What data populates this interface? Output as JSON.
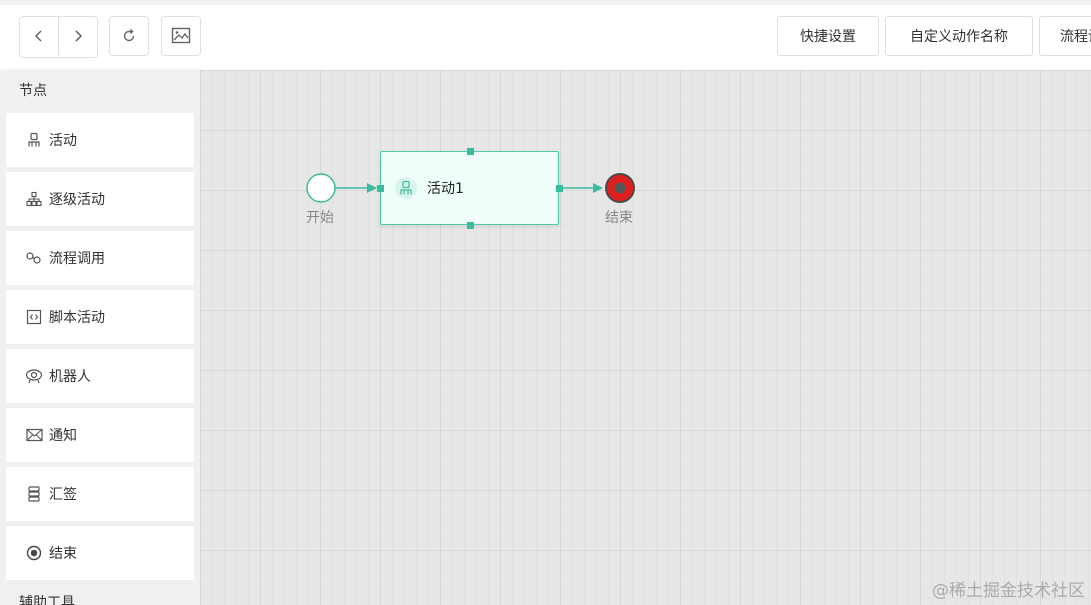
{
  "toolbar": {
    "back_icon": "chevron-left-icon",
    "forward_icon": "chevron-right-icon",
    "reset_icon": "refresh-icon",
    "image_icon": "image-icon",
    "quick_settings_label": "快捷设置",
    "custom_action_label": "自定义动作名称",
    "process_label": "流程设"
  },
  "sidebar": {
    "nodes_title": "节点",
    "items": [
      {
        "label": "活动",
        "icon": "person-icon"
      },
      {
        "label": "逐级活动",
        "icon": "org-tree-icon"
      },
      {
        "label": "流程调用",
        "icon": "link-chain-icon"
      },
      {
        "label": "脚本活动",
        "icon": "code-box-icon"
      },
      {
        "label": "机器人",
        "icon": "robot-icon"
      },
      {
        "label": "通知",
        "icon": "envelope-icon"
      },
      {
        "label": "汇签",
        "icon": "stack-icon"
      },
      {
        "label": "结束",
        "icon": "radio-dot-icon"
      }
    ],
    "tools_title": "辅助工具"
  },
  "canvas": {
    "start_label": "开始",
    "activity_label": "活动1",
    "end_label": "结束",
    "accent_color": "#3cba9c",
    "end_color": "#e02020",
    "watermark": "@稀土掘金技术社区"
  }
}
